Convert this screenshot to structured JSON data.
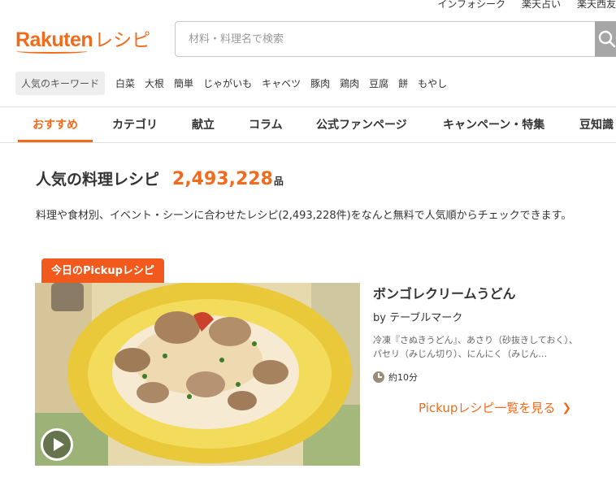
{
  "header": {
    "top_links": [
      "インフォシーク",
      "楽天占い",
      "楽天西友"
    ],
    "logo": {
      "brand": "Rakuten",
      "product": "レシピ"
    },
    "search": {
      "placeholder": "材料・料理名で検索"
    }
  },
  "keywords": {
    "label": "人気のキーワード",
    "items": [
      "白菜",
      "大根",
      "簡単",
      "じゃがいも",
      "キャベツ",
      "豚肉",
      "鶏肉",
      "豆腐",
      "餅",
      "もやし"
    ]
  },
  "nav": {
    "tabs": [
      "おすすめ",
      "カテゴリ",
      "献立",
      "コラム",
      "公式ファンページ",
      "キャンペーン・特集",
      "豆知識"
    ],
    "active_index": 0
  },
  "main": {
    "title": "人気の料理レシピ",
    "count": "2,493,228",
    "unit": "品",
    "description": "料理や食材別、イベント・シーンに合わせたレシピ(2,493,228件)をなんと無料で人気順からチェックできます。"
  },
  "pickup": {
    "badge": "今日のPickupレシピ",
    "recipe": {
      "title": "ボンゴレクリームうどん",
      "author": "by テーブルマーク",
      "ingredients": "冷凍『さぬきうどん』、あさり（砂抜きしておく）、パセリ（みじん切り）、にんにく（みじん…",
      "time": "約10分"
    },
    "link": "Pickupレシピ一覧を見る"
  },
  "colors": {
    "accent": "#f26b1d",
    "badge": "#f25a1d"
  }
}
